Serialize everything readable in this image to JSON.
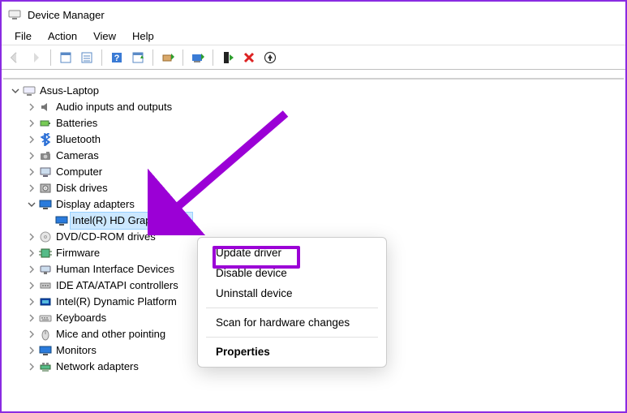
{
  "window": {
    "title": "Device Manager"
  },
  "menubar": [
    "File",
    "Action",
    "View",
    "Help"
  ],
  "toolbar_icons": [
    "back-icon",
    "forward-icon",
    "sep",
    "show-hidden-icon",
    "properties-icon",
    "sep",
    "help-icon",
    "scan-icon",
    "sep",
    "update-driver-icon",
    "sep",
    "uninstall-driver-icon",
    "sep",
    "disable-icon",
    "remove-icon",
    "details-icon"
  ],
  "root": {
    "label": "Asus-Laptop"
  },
  "categories": [
    {
      "label": "Audio inputs and outputs",
      "icon": "audio-icon",
      "expanded": false
    },
    {
      "label": "Batteries",
      "icon": "battery-icon",
      "expanded": false
    },
    {
      "label": "Bluetooth",
      "icon": "bluetooth-icon",
      "expanded": false
    },
    {
      "label": "Cameras",
      "icon": "camera-icon",
      "expanded": false
    },
    {
      "label": "Computer",
      "icon": "computer-icon",
      "expanded": false
    },
    {
      "label": "Disk drives",
      "icon": "disk-icon",
      "expanded": false
    },
    {
      "label": "Display adapters",
      "icon": "display-icon",
      "expanded": true,
      "children": [
        {
          "label": "Intel(R) HD Graphics 620",
          "icon": "display-icon",
          "selected": true
        }
      ]
    },
    {
      "label": "DVD/CD-ROM drives",
      "icon": "dvd-icon",
      "expanded": false
    },
    {
      "label": "Firmware",
      "icon": "firmware-icon",
      "expanded": false
    },
    {
      "label": "Human Interface Devices",
      "icon": "hid-icon",
      "expanded": false
    },
    {
      "label": "IDE ATA/ATAPI controllers",
      "icon": "ide-icon",
      "expanded": false
    },
    {
      "label": "Intel(R) Dynamic Platform",
      "icon": "intel-icon",
      "expanded": false
    },
    {
      "label": "Keyboards",
      "icon": "keyboard-icon",
      "expanded": false
    },
    {
      "label": "Mice and other pointing",
      "icon": "mouse-icon",
      "expanded": false
    },
    {
      "label": "Monitors",
      "icon": "monitor-icon",
      "expanded": false
    },
    {
      "label": "Network adapters",
      "icon": "network-icon",
      "expanded": false
    }
  ],
  "context_menu": {
    "items": [
      {
        "label": "Update driver",
        "highlight": true
      },
      {
        "label": "Disable device"
      },
      {
        "label": "Uninstall device"
      },
      {
        "sep": true
      },
      {
        "label": "Scan for hardware changes"
      },
      {
        "sep": true
      },
      {
        "label": "Properties",
        "bold": true
      }
    ]
  }
}
